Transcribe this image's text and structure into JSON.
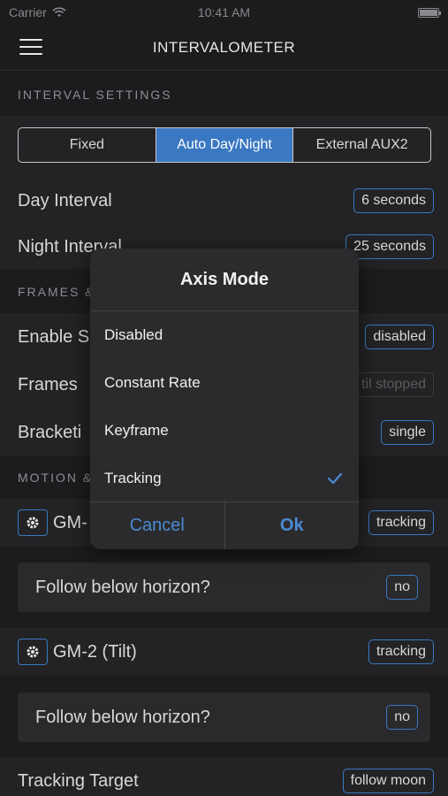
{
  "status": {
    "carrier": "Carrier",
    "time": "10:41 AM"
  },
  "nav": {
    "title": "INTERVALOMETER"
  },
  "interval_settings": {
    "header": "INTERVAL SETTINGS",
    "segments": [
      "Fixed",
      "Auto Day/Night",
      "External AUX2"
    ],
    "selected_segment": "Auto Day/Night",
    "day_interval": {
      "label": "Day Interval",
      "value": "6 seconds"
    },
    "night_interval": {
      "label": "Night Interval",
      "value": "25 seconds"
    }
  },
  "frames": {
    "header": "FRAMES &",
    "enable": {
      "label": "Enable S",
      "value": "disabled"
    },
    "frames": {
      "label": "Frames",
      "value": "til stopped"
    },
    "bracketing": {
      "label": "Bracketi",
      "value": "single"
    }
  },
  "motion": {
    "header": "MOTION &",
    "axis1": {
      "label": "GM-",
      "value": "tracking"
    },
    "follow1": {
      "label": "Follow below horizon?",
      "value": "no"
    },
    "axis2": {
      "label": "GM-2 (Tilt)",
      "value": "tracking"
    },
    "follow2": {
      "label": "Follow below horizon?",
      "value": "no"
    },
    "tracking_target": {
      "label": "Tracking Target",
      "value": "follow moon"
    }
  },
  "dialog": {
    "title": "Axis Mode",
    "options": [
      "Disabled",
      "Constant Rate",
      "Keyframe",
      "Tracking"
    ],
    "selected": "Tracking",
    "cancel": "Cancel",
    "ok": "Ok"
  },
  "colors": {
    "accent": "#3a78c2",
    "background": "#1c1c1e",
    "row": "#232325"
  },
  "icons": [
    "wifi-icon",
    "battery-icon",
    "menu-icon",
    "gear-icon",
    "checkmark-icon"
  ]
}
